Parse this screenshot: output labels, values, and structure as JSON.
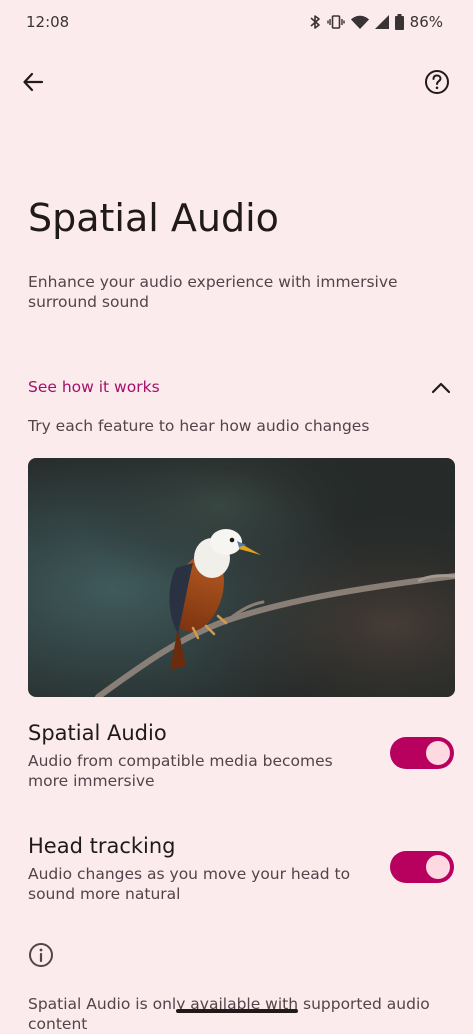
{
  "status_bar": {
    "time": "12:08",
    "battery": "86%",
    "icons": [
      "bluetooth-icon",
      "vibrate-icon",
      "wifi-icon",
      "signal-icon",
      "battery-icon"
    ]
  },
  "app_bar": {
    "back_icon": "arrow-back-icon",
    "help_icon": "help-icon"
  },
  "page": {
    "title": "Spatial Audio",
    "description": "Enhance your audio experience with immersive surround sound"
  },
  "how_it_works": {
    "title": "See how it works",
    "subtitle": "Try each feature to hear how audio changes",
    "expanded": true
  },
  "settings": [
    {
      "title": "Spatial Audio",
      "summary": "Audio from compatible media becomes more immersive",
      "enabled": true
    },
    {
      "title": "Head tracking",
      "summary": "Audio changes as you move your head to sound more natural",
      "enabled": true
    }
  ],
  "footer": {
    "info_icon": "info-icon",
    "text": "Spatial Audio is only available with supported audio content"
  },
  "colors": {
    "background": "#fcebec",
    "accent": "#a3106a",
    "switch_track": "#b8005f",
    "switch_thumb": "#ffd9e2"
  }
}
